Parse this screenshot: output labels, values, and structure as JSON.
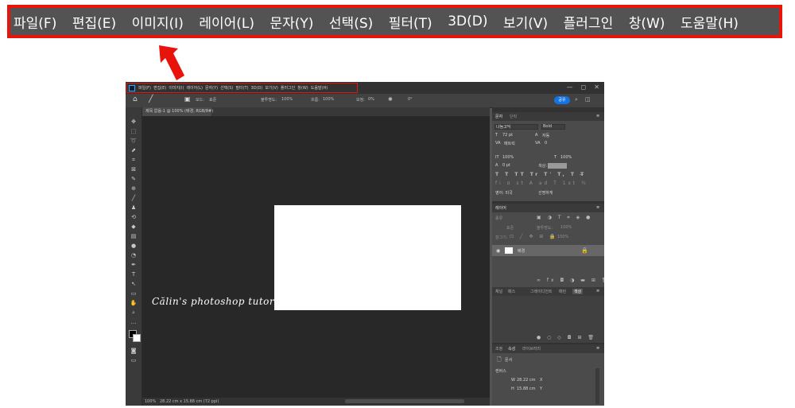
{
  "menu": {
    "items": [
      "파일(F)",
      "편집(E)",
      "이미지(I)",
      "레이어(L)",
      "문자(Y)",
      "선택(S)",
      "필터(T)",
      "3D(D)",
      "보기(V)",
      "플러그인",
      "창(W)",
      "도움말(H)"
    ]
  },
  "small_menu": {
    "items": [
      "파일(F)",
      "편집(E)",
      "이미지(I)",
      "레이어(L)",
      "문자(Y)",
      "선택(S)",
      "필터(T)",
      "3D(D)",
      "보기(V)",
      "플러그인",
      "창(W)",
      "도움말(H)"
    ]
  },
  "window_controls": [
    "—",
    "◻",
    "✕"
  ],
  "options_bar": {
    "mode_label": "모드:",
    "mode_value": "표준",
    "opacity_label": "불투명도:",
    "opacity_value": "100%",
    "flow_label": "흐름:",
    "flow_value": "100%",
    "smoothing_label": "보정:",
    "smoothing_value": "0%",
    "angle_value": "0°",
    "share_label": "공유"
  },
  "document": {
    "tab_title": "제목 없음-1 @ 100% (배경, RGB/8#)",
    "watermark": "Călin's photoshop tutorial",
    "status_zoom": "100%",
    "status_size": "28.22 cm x 15.88 cm (72 ppi)"
  },
  "character_panel": {
    "tabs": [
      "문자",
      "단락"
    ],
    "font_family": "나눔고딕",
    "font_style": "Bold",
    "font_size": "72 pt",
    "leading": "자동",
    "kerning": "메트릭",
    "tracking": "0",
    "vscale": "100%",
    "hscale": "100%",
    "baseline": "0 pt",
    "color_label": "색상:",
    "language": "영어: 미국",
    "antialias": "선명하게"
  },
  "layers_panel": {
    "title": "레이어",
    "search_placeholder": "종류",
    "blend_mode": "표준",
    "opacity_label": "불투명도:",
    "opacity_value": "100%",
    "lock_label": "잠그기:",
    "fill_label": "칠:",
    "fill_value": "100%",
    "layer_name": "배경"
  },
  "history_panel": {
    "tabs": [
      "채널",
      "패스",
      "그레이디언트",
      "패턴",
      "색상"
    ]
  },
  "properties_panel": {
    "tabs": [
      "조정",
      "속성",
      "라이브러리"
    ],
    "section": "문서",
    "canvas_label": "캔버스",
    "width_label": "W",
    "width_value": "28.22 cm",
    "height_label": "H",
    "height_value": "15.88 cm",
    "x_label": "X",
    "y_label": "Y"
  }
}
